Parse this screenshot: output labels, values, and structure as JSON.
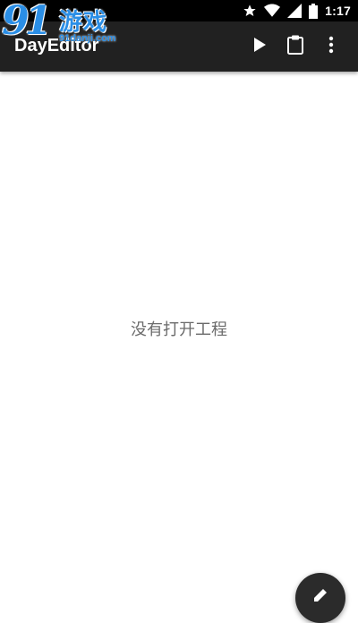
{
  "status_bar": {
    "time": "1:17",
    "icons": [
      "star-icon",
      "wifi-icon",
      "signal-icon",
      "battery-icon"
    ]
  },
  "watermark": {
    "logo": "91",
    "brand_cn": "游戏",
    "url": "91danji.com"
  },
  "app_bar": {
    "title": "DayEditor",
    "actions": [
      "play-icon",
      "clipboard-icon",
      "more-vert-icon"
    ],
    "background": "#212121"
  },
  "main": {
    "empty_message": "没有打开工程"
  },
  "fab": {
    "icon": "edit-icon",
    "background": "#2b2b2b"
  }
}
